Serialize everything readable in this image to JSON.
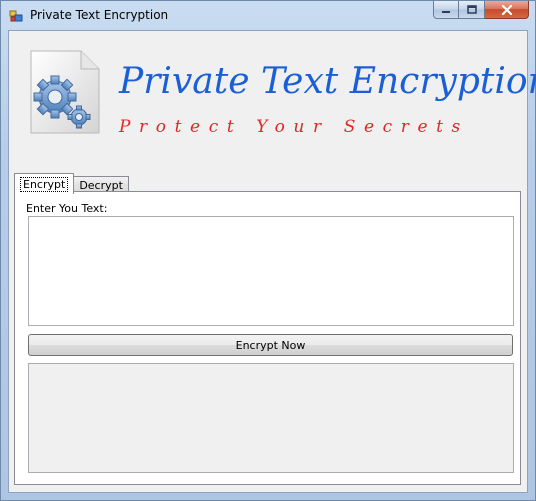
{
  "window": {
    "title": "Private Text Encryption",
    "caption_buttons": [
      "minimize-icon",
      "maximize-icon",
      "close-icon"
    ]
  },
  "banner": {
    "icon": "gear-document-icon",
    "title": "Private Text Encryption",
    "subtitle": "Protect Your Secrets",
    "title_color": "#1a5fd6",
    "subtitle_color": "#e22626"
  },
  "tabs": [
    {
      "label": "Encrypt",
      "active": true
    },
    {
      "label": "Decrypt",
      "active": false
    }
  ],
  "encrypt_page": {
    "prompt_label": "Enter You Text:",
    "input_value": "",
    "button_label": "Encrypt Now",
    "output_value": ""
  }
}
